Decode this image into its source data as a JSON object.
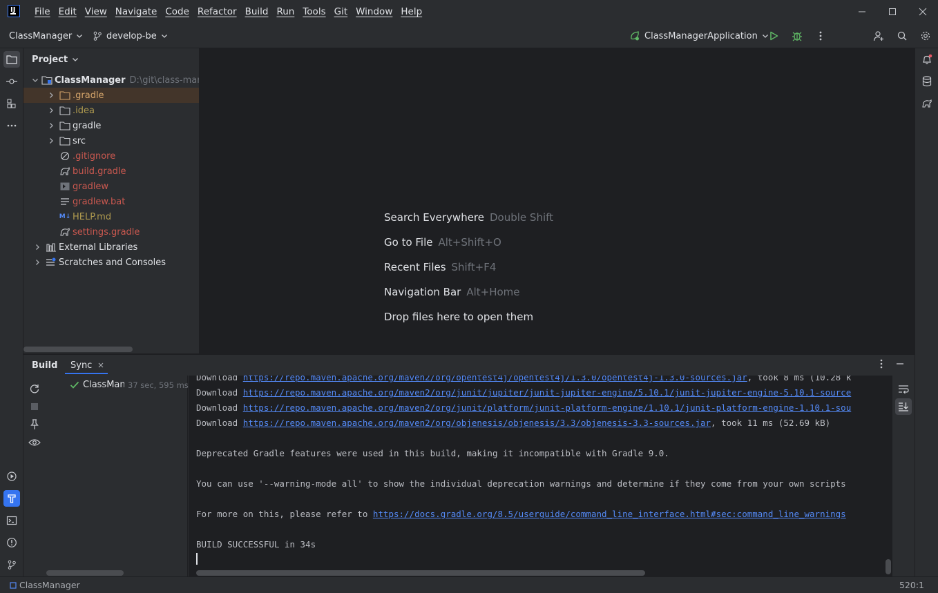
{
  "menu": [
    "File",
    "Edit",
    "View",
    "Navigate",
    "Code",
    "Refactor",
    "Build",
    "Run",
    "Tools",
    "Git",
    "Window",
    "Help"
  ],
  "toolbar": {
    "project_name": "ClassManager",
    "branch": "develop-be",
    "run_config": "ClassManagerApplication"
  },
  "project_panel": {
    "title": "Project",
    "root": {
      "name": "ClassManager",
      "path": "D:\\git\\class-mana"
    },
    "items": [
      {
        "name": ".gradle",
        "kind": "folder",
        "status": "ignored"
      },
      {
        "name": ".idea",
        "kind": "folder",
        "status": "idea"
      },
      {
        "name": "gradle",
        "kind": "folder",
        "status": "normal"
      },
      {
        "name": "src",
        "kind": "folder",
        "status": "normal"
      },
      {
        "name": ".gitignore",
        "kind": "ignore-file",
        "status": "untracked"
      },
      {
        "name": "build.gradle",
        "kind": "gradle-file",
        "status": "untracked"
      },
      {
        "name": "gradlew",
        "kind": "script-file",
        "status": "untracked"
      },
      {
        "name": "gradlew.bat",
        "kind": "text-file",
        "status": "untracked"
      },
      {
        "name": "HELP.md",
        "kind": "markdown-file",
        "status": "md"
      },
      {
        "name": "settings.gradle",
        "kind": "gradle-file",
        "status": "untracked"
      }
    ],
    "external_libraries": "External Libraries",
    "scratches": "Scratches and Consoles"
  },
  "editor_hints": [
    {
      "label": "Search Everywhere",
      "shortcut": "Double Shift"
    },
    {
      "label": "Go to File",
      "shortcut": "Alt+Shift+O"
    },
    {
      "label": "Recent Files",
      "shortcut": "Shift+F4"
    },
    {
      "label": "Navigation Bar",
      "shortcut": "Alt+Home"
    },
    {
      "label": "Drop files here to open them",
      "shortcut": ""
    }
  ],
  "bottom_panel": {
    "tabs": [
      "Build",
      "Sync"
    ],
    "build_tree": {
      "name": "ClassMana",
      "time": "37 sec, 595 ms"
    },
    "console": {
      "line1": {
        "prefix": "Download ",
        "url": "https://repo.maven.apache.org/maven2/org/opentest4j/opentest4j/1.3.0/opentest4j-1.3.0-sources.jar",
        "suffix": ", took 8 ms (10.28 k"
      },
      "line2": {
        "prefix": "Download ",
        "url": "https://repo.maven.apache.org/maven2/org/junit/jupiter/junit-jupiter-engine/5.10.1/junit-jupiter-engine-5.10.1-source"
      },
      "line3": {
        "prefix": "Download ",
        "url": "https://repo.maven.apache.org/maven2/org/junit/platform/junit-platform-engine/1.10.1/junit-platform-engine-1.10.1-sou"
      },
      "line4": {
        "prefix": "Download ",
        "url": "https://repo.maven.apache.org/maven2/org/objenesis/objenesis/3.3/objenesis-3.3-sources.jar",
        "suffix": ", took 11 ms (52.69 kB)"
      },
      "line5": "Deprecated Gradle features were used in this build, making it incompatible with Gradle 9.0.",
      "line6": "You can use '--warning-mode all' to show the individual deprecation warnings and determine if they come from your own scripts",
      "line7": {
        "prefix": "For more on this, please refer to ",
        "url": "https://docs.gradle.org/8.5/userguide/command_line_interface.html#sec:command_line_warnings"
      },
      "line8": "BUILD SUCCESSFUL in 34s"
    }
  },
  "statusbar": {
    "project": "ClassManager",
    "position": "520:1"
  },
  "colors": {
    "accent": "#3574f0",
    "success": "#5fb865",
    "untracked": "#c9584f",
    "ignored": "#d5a56b",
    "link": "#548af7"
  }
}
